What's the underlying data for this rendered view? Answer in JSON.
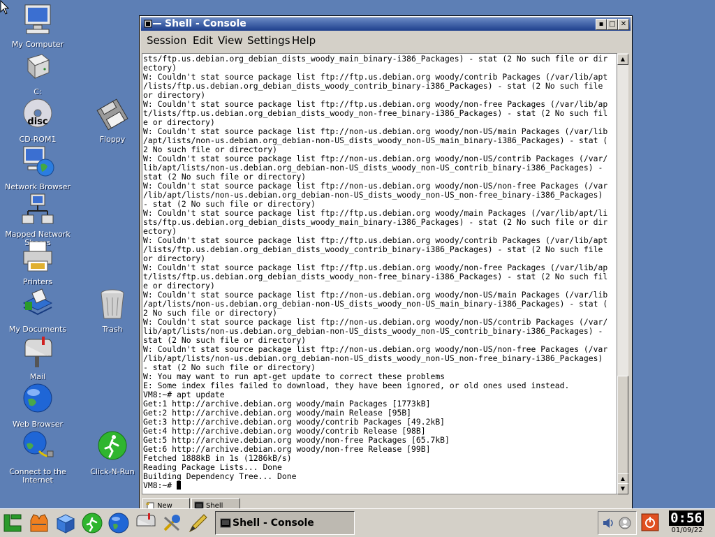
{
  "desktop": {
    "icons": [
      {
        "label": "My Computer",
        "icon": "monitor-icon"
      },
      {
        "label": "C:",
        "icon": "hard-drive-icon"
      },
      {
        "label": "CD-ROM1",
        "icon": "cd-rom-icon",
        "disc_text": "disc"
      },
      {
        "label": "Floppy",
        "icon": "floppy-icon"
      },
      {
        "label": "Network Browser",
        "icon": "network-globe-icon"
      },
      {
        "label": "Mapped Network Shares",
        "icon": "mapped-network-icon"
      },
      {
        "label": "Printers",
        "icon": "printer-icon"
      },
      {
        "label": "My Documents",
        "icon": "documents-icon"
      },
      {
        "label": "Trash",
        "icon": "trash-icon"
      },
      {
        "label": "Mail",
        "icon": "mailbox-icon"
      },
      {
        "label": "Web Browser",
        "icon": "globe-icon"
      },
      {
        "label": "Connect to the Internet",
        "icon": "connect-internet-icon"
      },
      {
        "label": "Click-N-Run",
        "icon": "click-n-run-icon"
      }
    ]
  },
  "window": {
    "title": "Shell - Console",
    "menu": [
      "Session",
      "Edit",
      "View",
      "Settings",
      "Help"
    ],
    "console_lines": [
      "sts/ftp.us.debian.org_debian_dists_woody_main_binary-i386_Packages) - stat (2 No such file or dir",
      "ectory)",
      "W: Couldn't stat source package list ftp://ftp.us.debian.org woody/contrib Packages (/var/lib/apt",
      "/lists/ftp.us.debian.org_debian_dists_woody_contrib_binary-i386_Packages) - stat (2 No such file",
      "or directory)",
      "W: Couldn't stat source package list ftp://ftp.us.debian.org woody/non-free Packages (/var/lib/ap",
      "t/lists/ftp.us.debian.org_debian_dists_woody_non-free_binary-i386_Packages) - stat (2 No such fil",
      "e or directory)",
      "W: Couldn't stat source package list ftp://non-us.debian.org woody/non-US/main Packages (/var/lib",
      "/apt/lists/non-us.debian.org_debian-non-US_dists_woody_non-US_main_binary-i386_Packages) - stat (",
      "2 No such file or directory)",
      "W: Couldn't stat source package list ftp://non-us.debian.org woody/non-US/contrib Packages (/var/",
      "lib/apt/lists/non-us.debian.org_debian-non-US_dists_woody_non-US_contrib_binary-i386_Packages) -",
      "stat (2 No such file or directory)",
      "W: Couldn't stat source package list ftp://non-us.debian.org woody/non-US/non-free Packages (/var",
      "/lib/apt/lists/non-us.debian.org_debian-non-US_dists_woody_non-US_non-free_binary-i386_Packages)",
      "- stat (2 No such file or directory)",
      "W: Couldn't stat source package list ftp://ftp.us.debian.org woody/main Packages (/var/lib/apt/li",
      "sts/ftp.us.debian.org_debian_dists_woody_main_binary-i386_Packages) - stat (2 No such file or dir",
      "ectory)",
      "W: Couldn't stat source package list ftp://ftp.us.debian.org woody/contrib Packages (/var/lib/apt",
      "/lists/ftp.us.debian.org_debian_dists_woody_contrib_binary-i386_Packages) - stat (2 No such file",
      "or directory)",
      "W: Couldn't stat source package list ftp://ftp.us.debian.org woody/non-free Packages (/var/lib/ap",
      "t/lists/ftp.us.debian.org_debian_dists_woody_non-free_binary-i386_Packages) - stat (2 No such fil",
      "e or directory)",
      "W: Couldn't stat source package list ftp://non-us.debian.org woody/non-US/main Packages (/var/lib",
      "/apt/lists/non-us.debian.org_debian-non-US_dists_woody_non-US_main_binary-i386_Packages) - stat (",
      "2 No such file or directory)",
      "W: Couldn't stat source package list ftp://non-us.debian.org woody/non-US/contrib Packages (/var/",
      "lib/apt/lists/non-us.debian.org_debian-non-US_dists_woody_non-US_contrib_binary-i386_Packages) -",
      "stat (2 No such file or directory)",
      "W: Couldn't stat source package list ftp://non-us.debian.org woody/non-US/non-free Packages (/var",
      "/lib/apt/lists/non-us.debian.org_debian-non-US_dists_woody_non-US_non-free_binary-i386_Packages)",
      "- stat (2 No such file or directory)",
      "W: You may want to run apt-get update to correct these problems",
      "E: Some index files failed to download, they have been ignored, or old ones used instead.",
      "VM8:~# apt update",
      "Get:1 http://archive.debian.org woody/main Packages [1773kB]",
      "Get:2 http://archive.debian.org woody/main Release [95B]",
      "Get:3 http://archive.debian.org woody/contrib Packages [49.2kB]",
      "Get:4 http://archive.debian.org woody/contrib Release [98B]",
      "Get:5 http://archive.debian.org woody/non-free Packages [65.7kB]",
      "Get:6 http://archive.debian.org woody/non-free Release [99B]",
      "Fetched 1888kB in 1s (1286kB/s)",
      "Reading Package Lists... Done",
      "Building Dependency Tree... Done"
    ],
    "prompt": "VM8:~# ",
    "tabs": [
      "New",
      "Shell"
    ]
  },
  "taskbar": {
    "quick_launch": [
      "start-menu-icon",
      "vest-icon",
      "cube-icon",
      "runner-icon",
      "globe-icon",
      "mailbox-icon",
      "tools-icon",
      "pen-icon"
    ],
    "task_button": "Shell - Console",
    "time": "0:56",
    "date": "01/09/22"
  }
}
